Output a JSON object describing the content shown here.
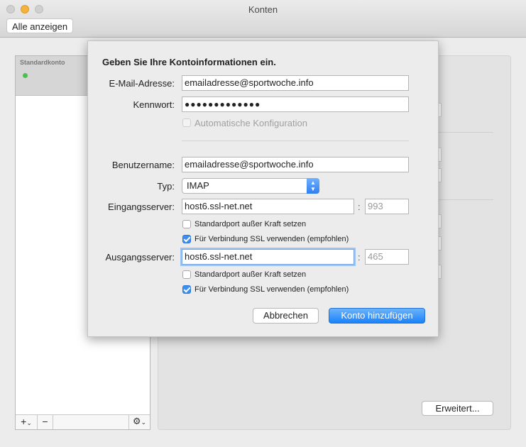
{
  "window": {
    "title": "Konten",
    "show_all": "Alle anzeigen"
  },
  "sidebar": {
    "header_label": "Standardkonto",
    "add_label": "+",
    "add_chevron": "⌄",
    "remove_label": "−",
    "gear_label": "⚙",
    "gear_chevron": "⌄"
  },
  "panel": {
    "advanced_label": "Erweitert..."
  },
  "sheet": {
    "heading": "Geben Sie Ihre Kontoinformationen ein.",
    "email": {
      "label": "E-Mail-Adresse:",
      "value": "emailadresse@sportwoche.info"
    },
    "password": {
      "label": "Kennwort:",
      "value": "●●●●●●●●●●●●●"
    },
    "auto_config": {
      "label": "Automatische Konfiguration",
      "checked": false,
      "disabled": true
    },
    "username": {
      "label": "Benutzername:",
      "value": "emailadresse@sportwoche.info"
    },
    "type": {
      "label": "Typ:",
      "value": "IMAP"
    },
    "incoming": {
      "label": "Eingangsserver:",
      "value": "host6.ssl-net.net",
      "port_placeholder": "993",
      "override_port": {
        "label": "Standardport außer Kraft setzen",
        "checked": false
      },
      "use_ssl": {
        "label": "Für Verbindung SSL verwenden (empfohlen)",
        "checked": true
      }
    },
    "outgoing": {
      "label": "Ausgangsserver:",
      "value": "host6.ssl-net.net",
      "port_placeholder": "465",
      "override_port": {
        "label": "Standardport außer Kraft setzen",
        "checked": false
      },
      "use_ssl": {
        "label": "Für Verbindung SSL verwenden (empfohlen)",
        "checked": true
      }
    },
    "colon": ":",
    "cancel_label": "Abbrechen",
    "add_account_label": "Konto hinzufügen"
  },
  "colors": {
    "accent": "#1a82fb",
    "status_green": "#4cc04c"
  }
}
